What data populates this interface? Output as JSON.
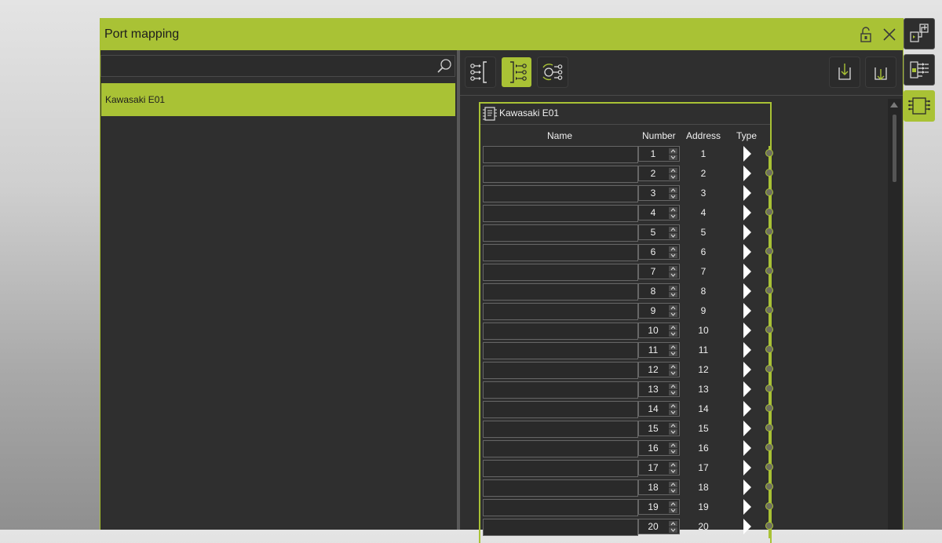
{
  "window": {
    "title": "Port mapping",
    "accent_color": "#a9c235",
    "icons": {
      "lock": "unlocked-lock-icon",
      "close": "close-icon"
    }
  },
  "left_panel": {
    "search": {
      "value": "",
      "placeholder": "",
      "icon": "search-icon"
    },
    "devices": [
      {
        "label": "Kawasaki E01",
        "selected": true
      }
    ]
  },
  "toolbar": {
    "buttons": [
      {
        "icon": "input-ports-icon",
        "active": false
      },
      {
        "icon": "output-ports-icon",
        "active": true
      },
      {
        "icon": "auto-connect-icon",
        "active": false
      }
    ],
    "right_buttons": [
      {
        "icon": "import-icon"
      },
      {
        "icon": "export-icon"
      }
    ]
  },
  "device": {
    "name": "Kawasaki E01",
    "icon": "device-icon",
    "columns": {
      "name": "Name",
      "number": "Number",
      "address": "Address",
      "type": "Type"
    },
    "rows": [
      {
        "name": "",
        "number": "1",
        "address": "1"
      },
      {
        "name": "",
        "number": "2",
        "address": "2"
      },
      {
        "name": "",
        "number": "3",
        "address": "3"
      },
      {
        "name": "",
        "number": "4",
        "address": "4"
      },
      {
        "name": "",
        "number": "5",
        "address": "5"
      },
      {
        "name": "",
        "number": "6",
        "address": "6"
      },
      {
        "name": "",
        "number": "7",
        "address": "7"
      },
      {
        "name": "",
        "number": "8",
        "address": "8"
      },
      {
        "name": "",
        "number": "9",
        "address": "9"
      },
      {
        "name": "",
        "number": "10",
        "address": "10"
      },
      {
        "name": "",
        "number": "11",
        "address": "11"
      },
      {
        "name": "",
        "number": "12",
        "address": "12"
      },
      {
        "name": "",
        "number": "13",
        "address": "13"
      },
      {
        "name": "",
        "number": "14",
        "address": "14"
      },
      {
        "name": "",
        "number": "15",
        "address": "15"
      },
      {
        "name": "",
        "number": "16",
        "address": "16"
      },
      {
        "name": "",
        "number": "17",
        "address": "17"
      },
      {
        "name": "",
        "number": "18",
        "address": "18"
      },
      {
        "name": "",
        "number": "19",
        "address": "19"
      },
      {
        "name": "",
        "number": "20",
        "address": "20"
      }
    ]
  },
  "side_toolbar": [
    {
      "icon": "signal-mapping-icon",
      "active": false
    },
    {
      "icon": "io-list-icon",
      "active": false
    },
    {
      "icon": "port-mapping-icon",
      "active": true
    }
  ]
}
